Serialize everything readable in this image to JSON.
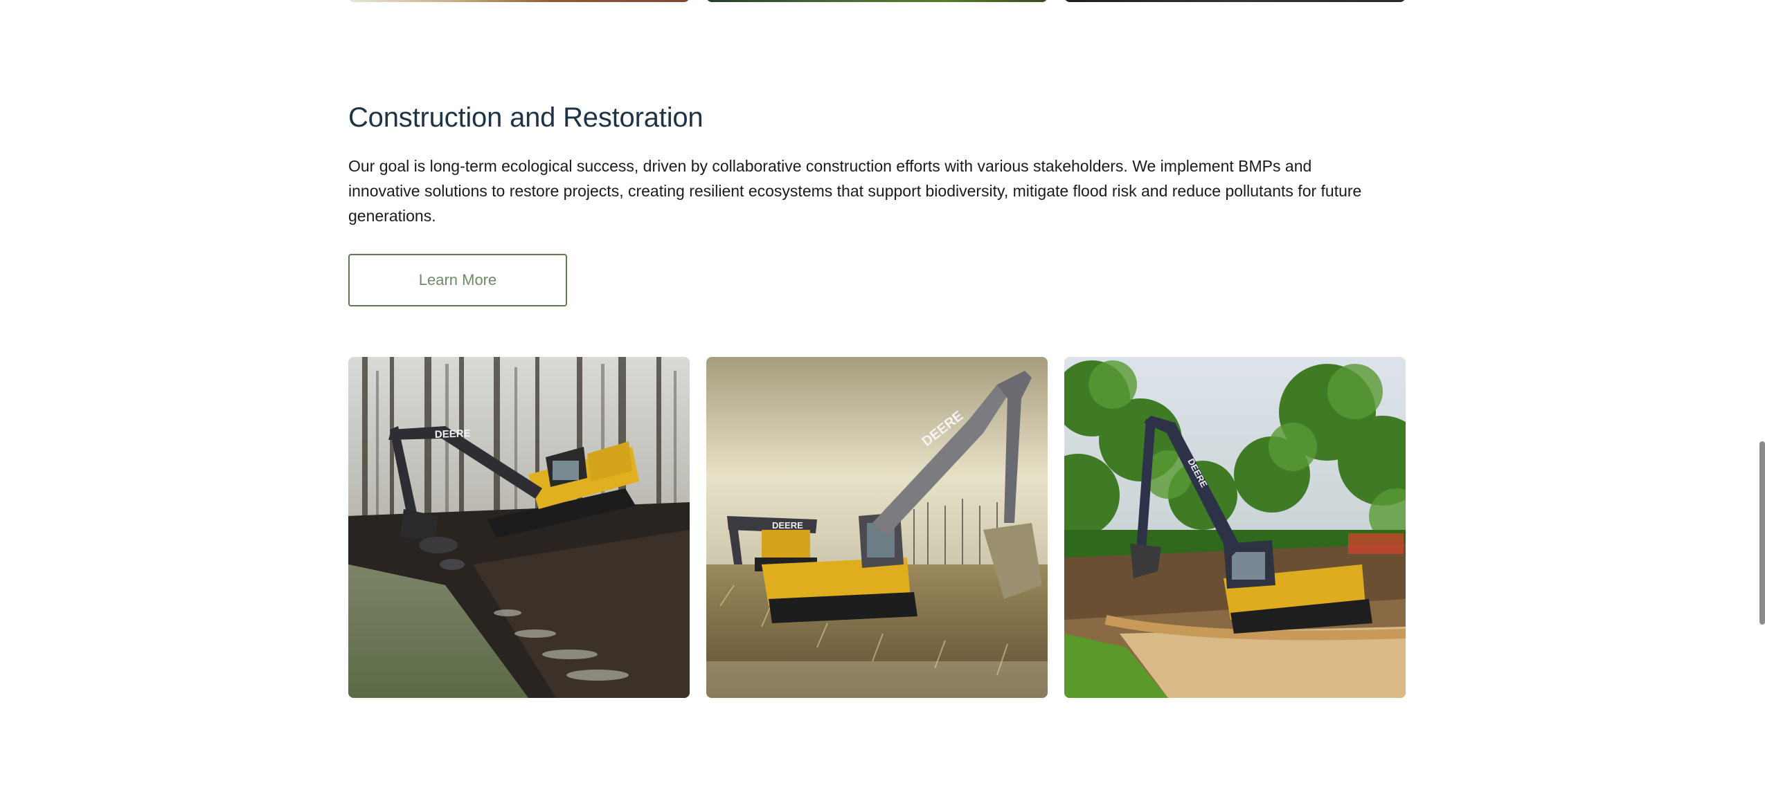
{
  "section": {
    "title": "Construction and Restoration",
    "description": "Our goal is long-term ecological success, driven by collaborative construction efforts with various stakeholders. We implement BMPs and innovative solutions to restore projects, creating resilient ecosystems that support biodiversity, mitigate flood risk and reduce pollutants for future generations.",
    "button_label": "Learn More"
  },
  "colors": {
    "title": "#1f3347",
    "button_border": "#5c7a52",
    "button_text": "#6f8a64"
  },
  "gallery": [
    {
      "name": "excavator-stream-photo",
      "description_icon": "photo"
    },
    {
      "name": "excavators-field-photo",
      "description_icon": "photo"
    },
    {
      "name": "excavator-forest-site-photo",
      "description_icon": "photo"
    }
  ],
  "photo_text": {
    "brand_1": "DEERE",
    "brand_2a": "DEERE",
    "brand_2b": "DEERE",
    "brand_3": "DEERE"
  }
}
